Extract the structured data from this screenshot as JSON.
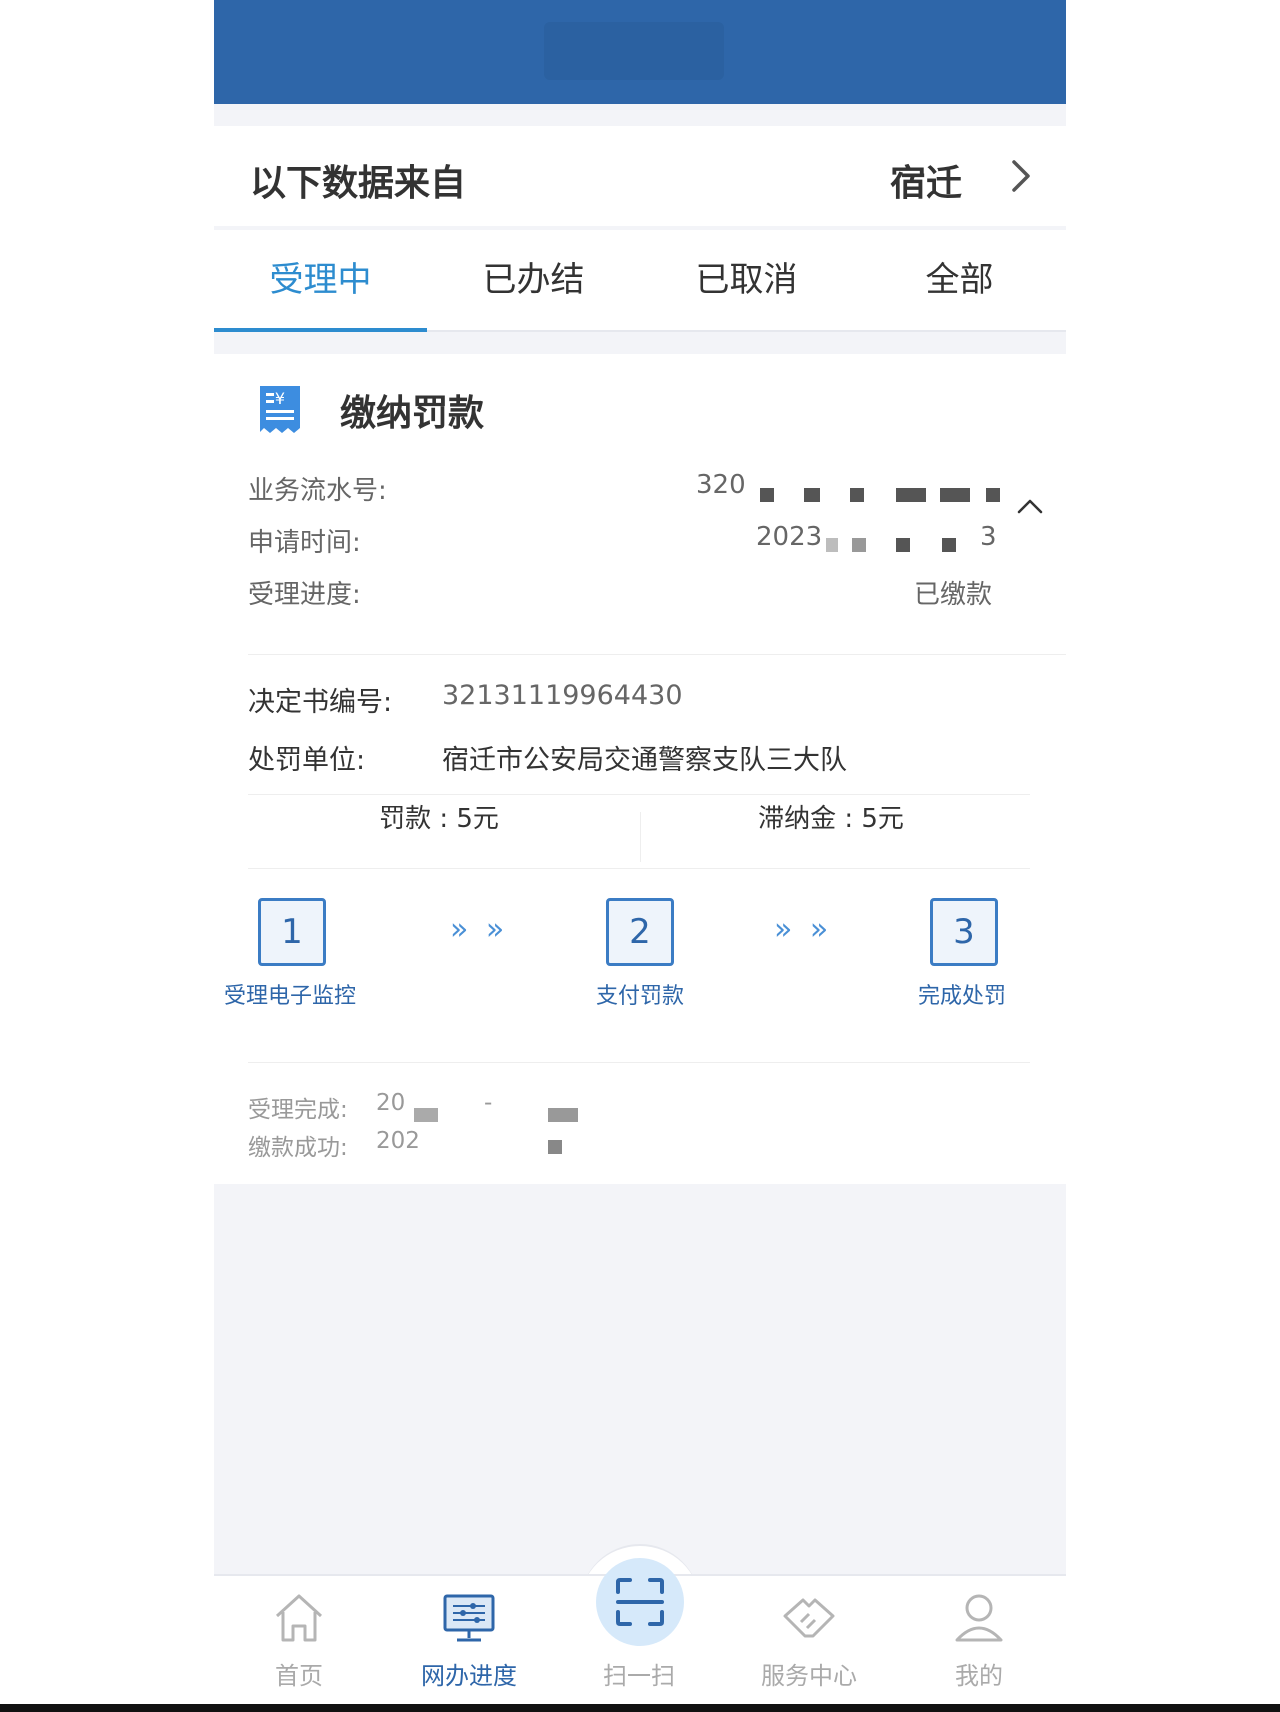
{
  "header": {
    "title": ""
  },
  "source": {
    "label": "以下数据来自",
    "city": "宿迁"
  },
  "tabs": [
    {
      "label": "受理中",
      "active": true
    },
    {
      "label": "已办结",
      "active": false
    },
    {
      "label": "已取消",
      "active": false
    },
    {
      "label": "全部",
      "active": false
    }
  ],
  "record": {
    "title": "缴纳罚款",
    "serial_label": "业务流水号:",
    "serial_value": "320",
    "apply_time_label": "申请时间:",
    "apply_time_value": "2023",
    "apply_time_tail": "3",
    "progress_label": "受理进度:",
    "progress_value": "已缴款",
    "decision_no_label": "决定书编号:",
    "decision_no_value": "32131119964430",
    "unit_label": "处罚单位:",
    "unit_value": "宿迁市公安局交通警察支队三大队",
    "fine_text": "罚款 : 5元",
    "late_fee_text": "滞纳金 : 5元",
    "steps": [
      {
        "num": "1",
        "label": "受理电子监控"
      },
      {
        "num": "2",
        "label": "支付罚款"
      },
      {
        "num": "3",
        "label": "完成处罚"
      }
    ],
    "step_arrow": "» »",
    "accept_done_label": "受理完成:",
    "accept_done_value": "20",
    "accept_done_dash": "-",
    "pay_success_label": "缴款成功:",
    "pay_success_value": "202"
  },
  "tabbar": [
    {
      "label": "首页",
      "icon": "home-icon",
      "active": false
    },
    {
      "label": "网办进度",
      "icon": "monitor-progress-icon",
      "active": true
    },
    {
      "label": "扫一扫",
      "icon": "scan-icon",
      "active": false
    },
    {
      "label": "服务中心",
      "icon": "handshake-icon",
      "active": false
    },
    {
      "label": "我的",
      "icon": "user-icon",
      "active": false
    }
  ],
  "colors": {
    "primary": "#2e66a9",
    "tab_active": "#2d8ccf",
    "background": "#f3f4f8"
  }
}
